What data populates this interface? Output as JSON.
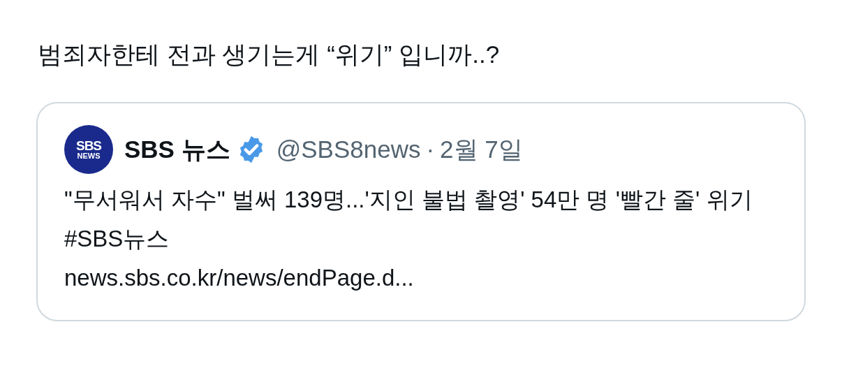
{
  "tweet": {
    "text": "범죄자한테 전과 생기는게 “위기” 입니까..?"
  },
  "quote": {
    "avatar": {
      "line_1": "SBS",
      "line_2": "NEWS"
    },
    "name": "SBS 뉴스",
    "verified": true,
    "handle": "@SBS8news",
    "separator": "·",
    "date": "2월 7일",
    "text": "\"무서워서 자수\" 벌써 139명...'지인 불법 촬영' 54만 명 '빨간 줄' 위기 #SBS뉴스",
    "link": "news.sbs.co.kr/news/endPage.d..."
  }
}
